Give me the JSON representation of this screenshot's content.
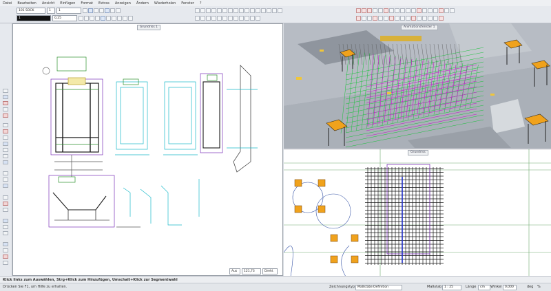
{
  "menu": [
    "Datei",
    "Bearbeiten",
    "Ansicht",
    "Einfügen",
    "Format",
    "Extras",
    "Anzeigen",
    "Ändern",
    "Wiederholen",
    "Fenster",
    "?"
  ],
  "toolbar": {
    "layer_combo": "101 SOCK",
    "scale_combo": "1",
    "line_combo": "1",
    "pen_value": "0,25",
    "color_value": "1"
  },
  "tabs": {
    "drawing": "Grundriss 1",
    "view3d": "Animationsfenster 1",
    "plan": "Grundriss"
  },
  "zoom": {
    "mode": "Aus",
    "value": "121,73",
    "unit": "Drehl."
  },
  "status": {
    "hint": "Klick links zum Auswählen, Strg+Klick zum Hinzufügen, Umschalt+Klick zur Segmentwahl",
    "help": "Drücken Sie F1, um Hilfe zu erhalten.",
    "drawing_type": "Zeichnungstyp",
    "drawing_type_value": "Maßstabs-Definition",
    "scale_label": "Maßstab",
    "scale_value": "1 : 25",
    "length_label": "Länge",
    "length_value": "cm",
    "angle_label": "Winkel",
    "angle_value": "0,000",
    "angle_unit": "deg",
    "pct": "%"
  },
  "colors": {
    "background": "#d9dde3",
    "rebar_green": "#18c23a",
    "rebar_magenta": "#c21fc9",
    "column_orange": "#f0a21c",
    "cyan_lines": "#18b9c9"
  }
}
